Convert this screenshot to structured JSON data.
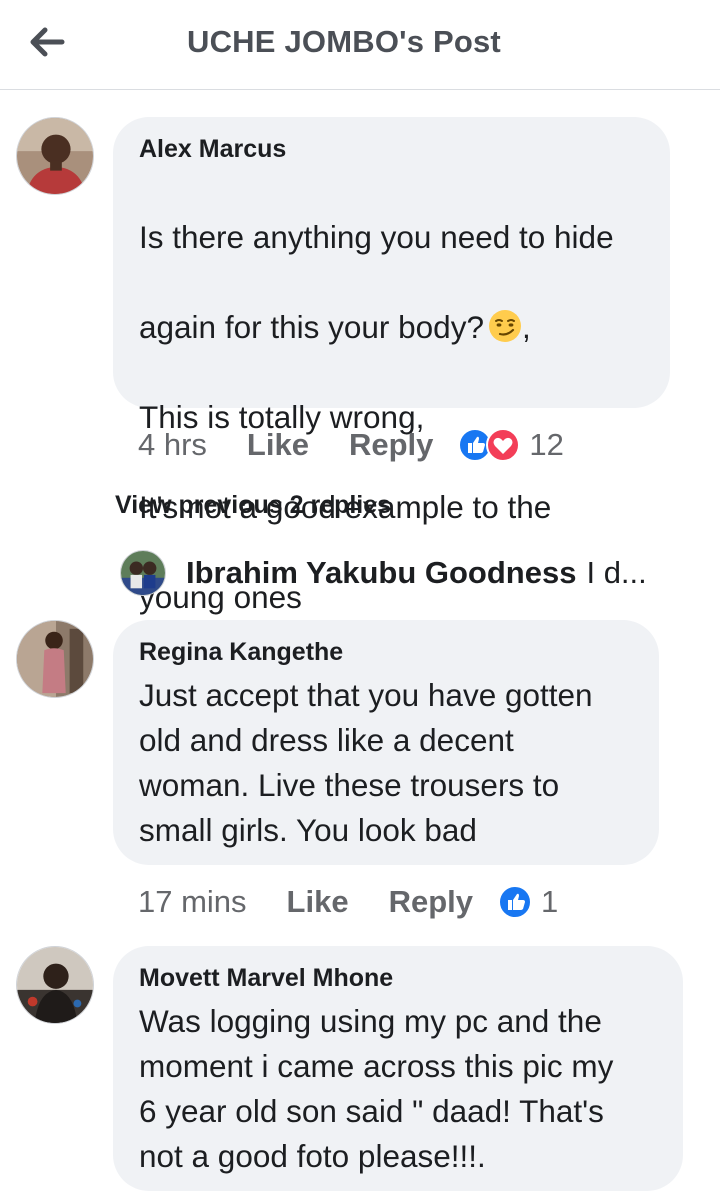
{
  "header": {
    "title": "UCHE JOMBO's Post",
    "back_icon": "arrow-left-icon"
  },
  "comments": [
    {
      "author": "Alex Marcus",
      "lines": [
        "Is there anything you need to hide",
        "again for this your body?",
        "This is totally wrong,",
        "It's not a good example to the",
        "young ones"
      ],
      "emoji": "smirk-face-icon",
      "emoji_suffix": ",",
      "time": "4 hrs",
      "like_label": "Like",
      "reply_label": "Reply",
      "reactions": [
        "like-reaction-icon",
        "love-reaction-icon"
      ],
      "reaction_count": "12"
    },
    {
      "author": "Regina Kangethe",
      "text": "Just accept that you have gotten\nold and dress like a  decent\nwoman. Live these trousers to\nsmall girls. You look  bad",
      "time": "17 mins",
      "like_label": "Like",
      "reply_label": "Reply",
      "reactions": [
        "like-reaction-icon"
      ],
      "reaction_count": "1"
    },
    {
      "author": "Movett Marvel Mhone",
      "text": "Was logging using my pc and the\nmoment i came across this pic my\n6 year old son said \" daad! That's\nnot a good foto please!!!."
    }
  ],
  "replies": {
    "view_previous_label": "View previous 2 replies",
    "latest_reply": {
      "author": "Ibrahim Yakubu Goodness",
      "snippet": "I d..."
    }
  },
  "colors": {
    "bubble_bg": "#f0f2f5",
    "meta_text": "#65676b",
    "like_blue": "#1877f2",
    "love_red": "#f33e58",
    "header_text": "#4b4f56"
  }
}
